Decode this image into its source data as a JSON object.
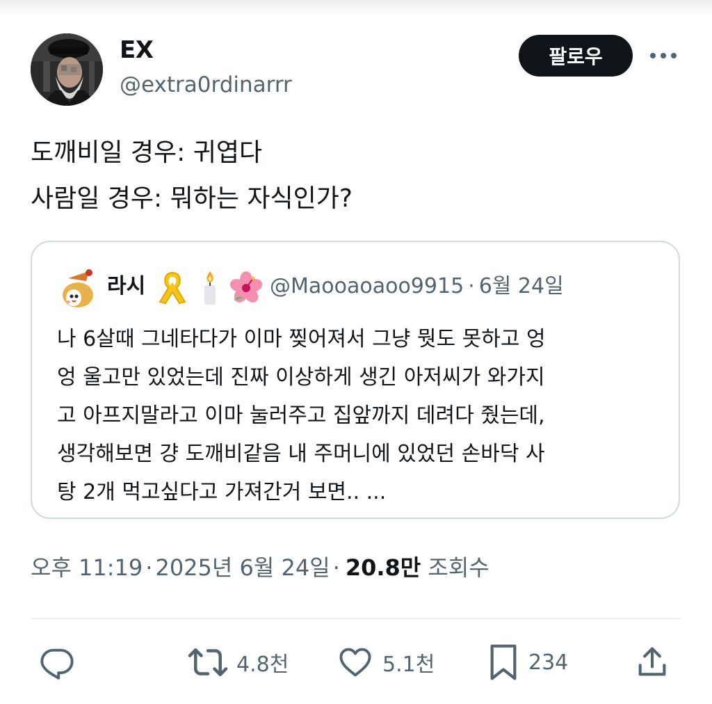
{
  "author": {
    "name": "EX",
    "handle": "@extra0rdinarrr",
    "avatar_icon": "profile-photo"
  },
  "header": {
    "follow_label": "팔로우",
    "more_icon": "more-dots-icon"
  },
  "tweet": {
    "lines": [
      "도깨비일 경우: 귀엽다",
      "사람일 경우: 뭐하는 자식인가?"
    ]
  },
  "quote": {
    "name": "라시",
    "name_emojis": [
      "yellow-ribbon-icon",
      "candle-icon",
      "hibiscus-icon"
    ],
    "handle": "@Maooaoaoo9915",
    "separator": "·",
    "date": "6월 24일",
    "text_lines": [
      "나 6살때 그네타다가 이마 찢어져서 그냥 뭣도 못하고 엉",
      "엉 울고만 있었는데 진짜 이상하게 생긴 아저씨가 와가지",
      "고 아프지말라고 이마 눌러주고 집앞까지 데려다 줬는데,",
      "생각해보면 걍 도깨비같음 내 주머니에 있었던 손바닥 사",
      "탕 2개 먹고싶다고 가져간거 보면.. ..."
    ]
  },
  "meta": {
    "time": "오후 11:19",
    "separator": "·",
    "date": "2025년 6월 24일",
    "views": "20.8만",
    "views_label": "조회수"
  },
  "actions": {
    "reply": {
      "icon": "reply-icon"
    },
    "retweet": {
      "icon": "retweet-icon",
      "count": "4.8천"
    },
    "like": {
      "icon": "heart-icon",
      "count": "5.1천"
    },
    "bookmark": {
      "icon": "bookmark-icon",
      "count": "234"
    },
    "share": {
      "icon": "share-icon"
    }
  },
  "colors": {
    "text": "#0f1419",
    "secondary": "#536471",
    "border": "#cfd9de",
    "follow_bg": "#0f1419"
  }
}
